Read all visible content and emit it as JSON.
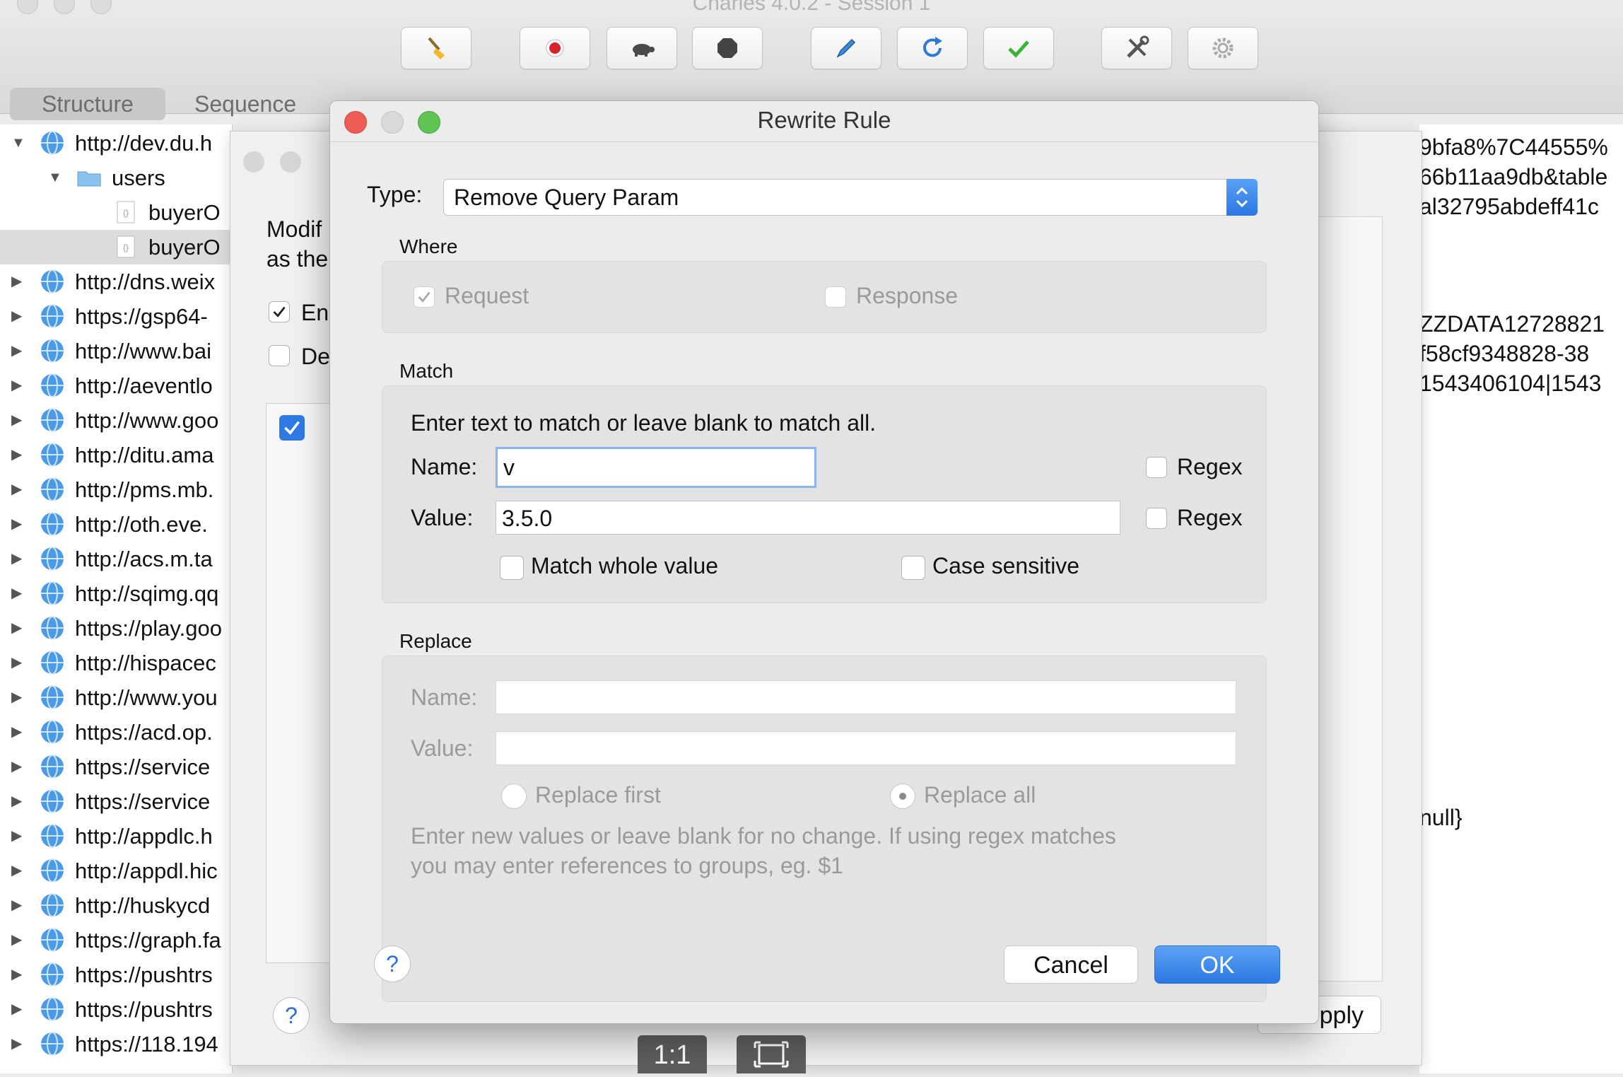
{
  "window": {
    "title": "Charles 4.0.2 - Session 1"
  },
  "toolbar": {
    "icons": [
      "broom-icon",
      "record-icon",
      "turtle-icon",
      "stop-hexagon-icon",
      "pen-icon",
      "refresh-icon",
      "check-icon",
      "tools-icon",
      "gear-icon"
    ]
  },
  "sidebar": {
    "segments": [
      "Structure",
      "Sequence"
    ],
    "tree": [
      {
        "label": "http://dev.du.h",
        "level": 0,
        "expanded": true
      },
      {
        "label": "users",
        "level": 1,
        "expanded": true,
        "folder": true
      },
      {
        "label": "buyerO",
        "level": 2,
        "file": true
      },
      {
        "label": "buyerO",
        "level": 2,
        "file": true,
        "selected": true
      },
      {
        "label": "http://dns.weix",
        "level": 0
      },
      {
        "label": "https://gsp64-",
        "level": 0
      },
      {
        "label": "http://www.bai",
        "level": 0
      },
      {
        "label": "http://aeventlo",
        "level": 0
      },
      {
        "label": "http://www.goo",
        "level": 0
      },
      {
        "label": "http://ditu.ama",
        "level": 0
      },
      {
        "label": "http://pms.mb.",
        "level": 0
      },
      {
        "label": "http://oth.eve.",
        "level": 0
      },
      {
        "label": "http://acs.m.ta",
        "level": 0
      },
      {
        "label": "http://sqimg.qq",
        "level": 0
      },
      {
        "label": "https://play.goo",
        "level": 0
      },
      {
        "label": "http://hispacec",
        "level": 0
      },
      {
        "label": "http://www.you",
        "level": 0
      },
      {
        "label": "https://acd.op.",
        "level": 0
      },
      {
        "label": "https://service",
        "level": 0
      },
      {
        "label": "https://service",
        "level": 0
      },
      {
        "label": "http://appdlc.h",
        "level": 0
      },
      {
        "label": "http://appdl.hic",
        "level": 0
      },
      {
        "label": "http://huskycd",
        "level": 0
      },
      {
        "label": "https://graph.fa",
        "level": 0
      },
      {
        "label": "https://pushtrs",
        "level": 0
      },
      {
        "label": "https://pushtrs",
        "level": 0
      },
      {
        "label": "https://118.194",
        "level": 0
      }
    ]
  },
  "background_sheet": {
    "text_line1": "Modif",
    "text_line2": "as the",
    "check1_label": "En",
    "check2_label": "De",
    "apply_label": "pply",
    "help_label": "?"
  },
  "right_panel": {
    "lines": [
      "9bfa8%7C44555%",
      "66b11aa9db&table",
      "al32795abdeff41c",
      "ZZDATA12728821",
      "f58cf9348828-38",
      "1543406104|1543",
      "null}"
    ]
  },
  "bottom_bar": {
    "zoom_label": "1:1"
  },
  "dialog": {
    "title": "Rewrite Rule",
    "type_label": "Type:",
    "type_value": "Remove Query Param",
    "where": {
      "title": "Where",
      "request_label": "Request",
      "request_checked": true,
      "response_label": "Response",
      "response_checked": false
    },
    "match": {
      "title": "Match",
      "hint": "Enter text to match or leave blank to match all.",
      "name_label": "Name:",
      "name_value": "v",
      "value_label": "Value:",
      "value_value": "3.5.0",
      "regex_label": "Regex",
      "match_whole_label": "Match whole value",
      "case_sensitive_label": "Case sensitive"
    },
    "replace": {
      "title": "Replace",
      "name_label": "Name:",
      "value_label": "Value:",
      "name_value": "",
      "value_value": "",
      "replace_first_label": "Replace first",
      "replace_all_label": "Replace all",
      "selected": "Replace all",
      "hint_line1": "Enter new values or leave blank for no change. If using regex matches",
      "hint_line2": "you may enter references to groups, eg. $1"
    },
    "help_label": "?",
    "cancel_label": "Cancel",
    "ok_label": "OK"
  },
  "colors": {
    "accent": "#2f7ae5",
    "close": "#ee5d55",
    "minimize": "#f4be4f",
    "zoom": "#5fc453"
  }
}
